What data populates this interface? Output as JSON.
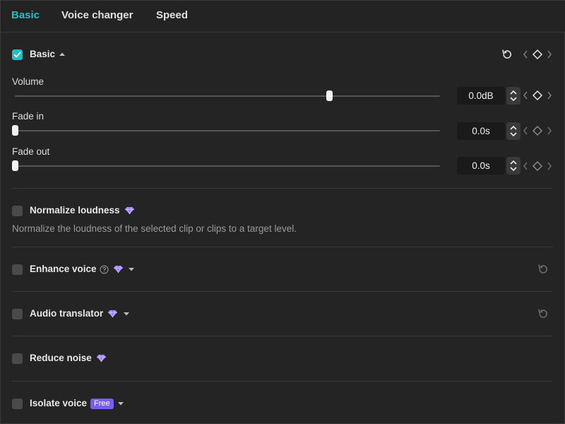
{
  "tabs": [
    {
      "label": "Basic",
      "active": true
    },
    {
      "label": "Voice changer",
      "active": false
    },
    {
      "label": "Speed",
      "active": false
    }
  ],
  "basic_section": {
    "title": "Basic",
    "checked": true,
    "params": [
      {
        "label": "Volume",
        "value": "0.0dB",
        "slider_fraction": 0.74
      },
      {
        "label": "Fade in",
        "value": "0.0s",
        "slider_fraction": 0.0
      },
      {
        "label": "Fade out",
        "value": "0.0s",
        "slider_fraction": 0.0
      }
    ]
  },
  "normalize": {
    "title": "Normalize loudness",
    "checked": false,
    "description": "Normalize the loudness of the selected clip or clips to a target level."
  },
  "enhance_voice": {
    "title": "Enhance voice",
    "checked": false
  },
  "audio_translator": {
    "title": "Audio translator",
    "checked": false
  },
  "reduce_noise": {
    "title": "Reduce noise",
    "checked": false
  },
  "isolate_voice": {
    "title": "Isolate voice",
    "checked": false,
    "badge": "Free"
  },
  "colors": {
    "accent": "#21bfc8",
    "premium": "#9b7bff",
    "free_badge": "#7a5cf0"
  },
  "icons": [
    "check-icon",
    "caret-up-icon",
    "caret-down-icon",
    "reset-icon",
    "keyframe-diamond-icon",
    "chevron-left-icon",
    "chevron-right-icon",
    "premium-gem-icon",
    "help-icon",
    "stepper-icon"
  ]
}
